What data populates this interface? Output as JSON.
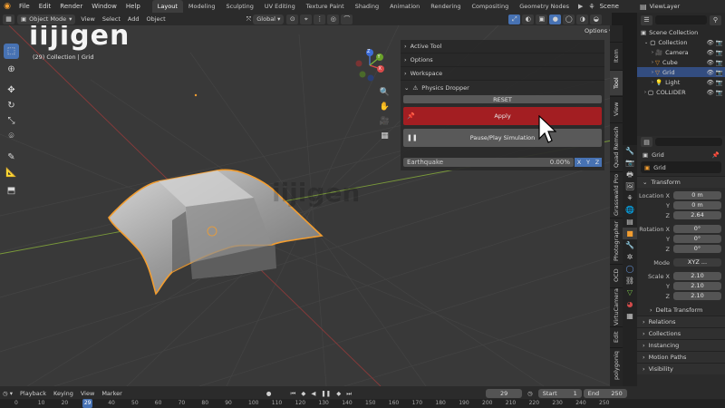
{
  "topbar": {
    "menus": [
      "File",
      "Edit",
      "Render",
      "Window",
      "Help"
    ],
    "workspaces": [
      "Layout",
      "Modeling",
      "Sculpting",
      "UV Editing",
      "Texture Paint",
      "Shading",
      "Animation",
      "Rendering",
      "Compositing",
      "Geometry Nodes"
    ],
    "active_workspace": "Layout",
    "scene": "Scene",
    "view_layer": "ViewLayer"
  },
  "viewport_header": {
    "mode": "Object Mode",
    "menus": [
      "View",
      "Select",
      "Add",
      "Object"
    ],
    "orientation": "Global",
    "options": "Options"
  },
  "viewport": {
    "info": "(29) Collection | Grid",
    "watermark": "iijigen",
    "gizmo": {
      "x": "X",
      "y": "Y",
      "z": "Z"
    },
    "accent_orange": "#f29d30"
  },
  "npanel": {
    "sections": [
      "Active Tool",
      "Options",
      "Workspace"
    ],
    "addon_title": "Physics Dropper",
    "reset_label": "RESET",
    "apply_label": "Apply",
    "pause_label": "Pause/Play Simulation",
    "earthquake_label": "Earthquake",
    "earthquake_value": "0.00%",
    "axes": [
      "X",
      "Y",
      "Z"
    ],
    "apply_color": "#a31e22"
  },
  "vtabs": [
    "Item",
    "Tool",
    "View",
    "Quad Remesh",
    "Grasswald Pro",
    "Photographer",
    "OCD",
    "VirtuCamera",
    "Edit",
    "polygoniq"
  ],
  "outliner": {
    "root": "Scene Collection",
    "items": [
      {
        "name": "Collection",
        "icon": "collection-icon"
      },
      {
        "name": "Camera",
        "icon": "camera-icon"
      },
      {
        "name": "Cube",
        "icon": "mesh-icon"
      },
      {
        "name": "Grid",
        "icon": "mesh-icon",
        "selected": true
      },
      {
        "name": "Light",
        "icon": "light-icon"
      },
      {
        "name": "COLLIDER",
        "icon": "collection-icon"
      }
    ]
  },
  "properties": {
    "object_name": "Grid",
    "data_name": "Grid",
    "transform": "Transform",
    "location_label": "Location X",
    "location": {
      "x": "0 m",
      "y": "0 m",
      "z": "2.64"
    },
    "rotation_label": "Rotation X",
    "rotation": {
      "x": "0°",
      "y": "0°",
      "z": "0°"
    },
    "mode_label": "Mode",
    "mode_value": "XYZ ...",
    "scale_label": "Scale X",
    "scale": {
      "x": "2.10",
      "y": "2.10",
      "z": "2.10"
    },
    "y_label": "Y",
    "z_label": "Z",
    "panels": [
      "Delta Transform",
      "Relations",
      "Collections",
      "Instancing",
      "Motion Paths",
      "Visibility"
    ]
  },
  "timeline": {
    "menus": [
      "Playback",
      "Keying",
      "View",
      "Marker"
    ],
    "current_frame": "29",
    "start_label": "Start",
    "start": "1",
    "end_label": "End",
    "end": "250",
    "ruler": [
      "0",
      "10",
      "20",
      "29",
      "40",
      "50",
      "60",
      "70",
      "80",
      "90",
      "100",
      "110",
      "120",
      "130",
      "140",
      "150",
      "160",
      "170",
      "180",
      "190",
      "200",
      "210",
      "220",
      "230",
      "240",
      "250"
    ]
  }
}
